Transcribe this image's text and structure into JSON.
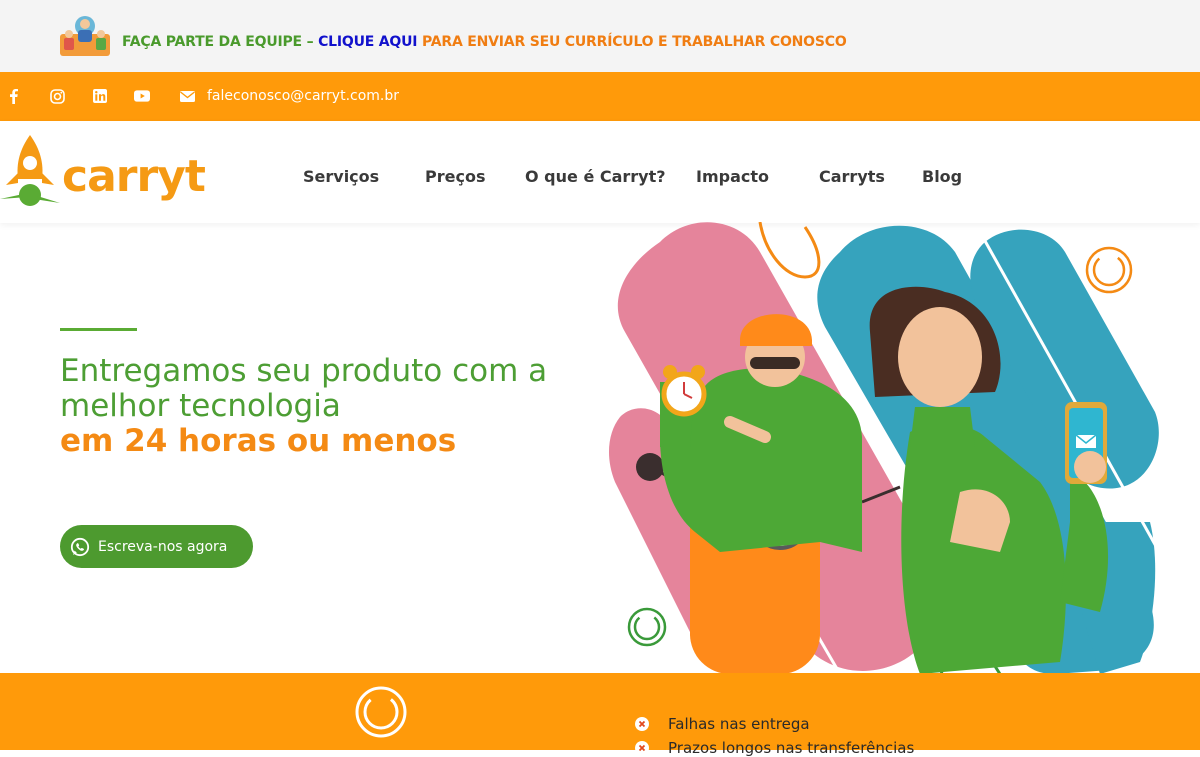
{
  "promo": {
    "part1": "FAÇA PARTE DA EQUIPE – ",
    "link": "CLIQUE AQUI",
    "part2": " PARA ENVIAR SEU CURRÍCULO E TRABALHAR CONOSCO"
  },
  "social": {
    "icons": [
      "facebook-icon",
      "instagram-icon",
      "linkedin-icon",
      "youtube-icon",
      "mail-icon"
    ],
    "email": "faleconosco@carryt.com.br"
  },
  "brand": {
    "logo_text": "carryt",
    "color": "#f59a14"
  },
  "nav": {
    "items": [
      "Serviços",
      "Preços",
      "O que é Carryt?",
      "Impacto",
      "Carryts",
      "Blog"
    ]
  },
  "hero": {
    "title_line1": "Entregamos seu produto com a",
    "title_line2": "melhor tecnologia",
    "title_emphasis": "em 24 horas ou menos",
    "cta_label": "Escreva-nos agora"
  },
  "problems": {
    "items": [
      "Falhas nas entrega",
      "Prazos longos nas transferências"
    ]
  },
  "colors": {
    "orange": "#ff9a0a",
    "green": "#4d9a2f",
    "pink": "#e5849b",
    "teal": "#36a3bd"
  }
}
